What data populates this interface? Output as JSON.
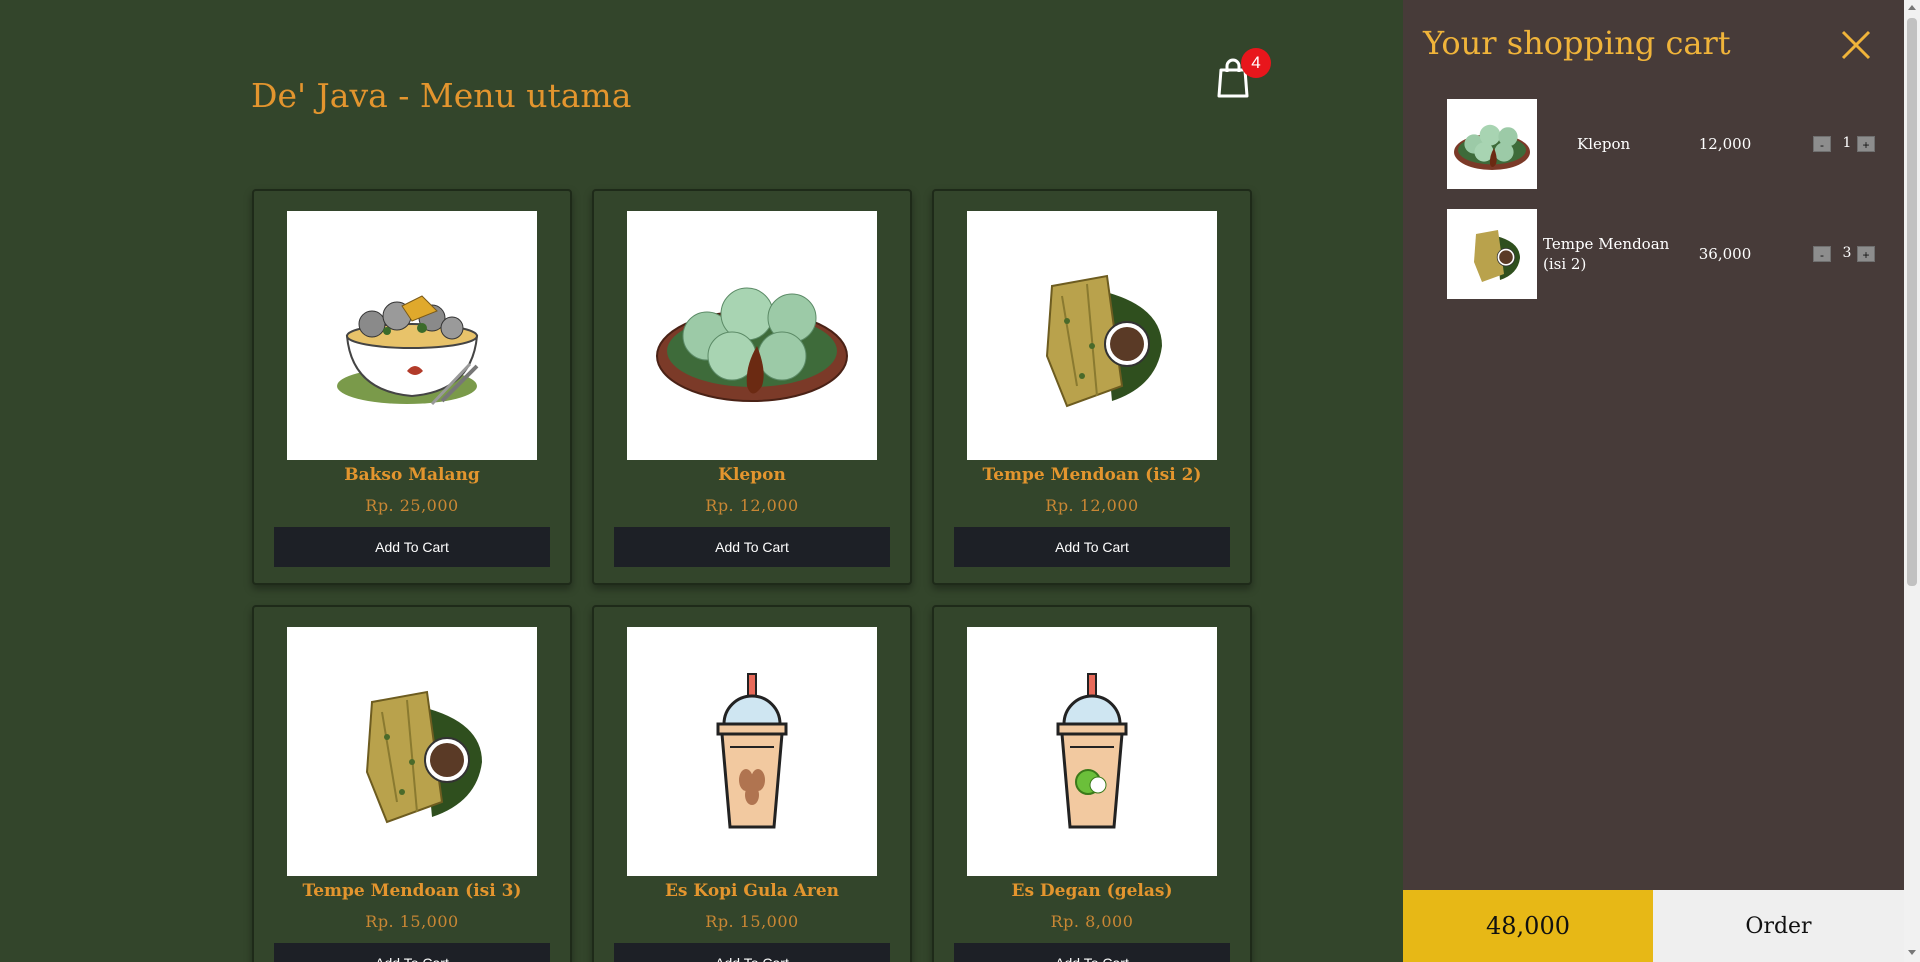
{
  "page": {
    "title": "De' Java - Menu utama",
    "cart_count": "4"
  },
  "menu": {
    "add_label": "Add To Cart",
    "items": [
      {
        "name": "Bakso Malang",
        "price": "Rp. 25,000",
        "icon": "bakso-bowl-icon"
      },
      {
        "name": "Klepon",
        "price": "Rp. 12,000",
        "icon": "klepon-plate-icon"
      },
      {
        "name": "Tempe Mendoan (isi 2)",
        "price": "Rp. 12,000",
        "icon": "tempe-mendoan-icon"
      },
      {
        "name": "Tempe Mendoan (isi 3)",
        "price": "Rp. 15,000",
        "icon": "tempe-mendoan-icon"
      },
      {
        "name": "Es Kopi Gula Aren",
        "price": "Rp. 15,000",
        "icon": "iced-coffee-cup-icon"
      },
      {
        "name": "Es Degan (gelas)",
        "price": "Rp. 8,000",
        "icon": "coconut-drink-cup-icon"
      }
    ]
  },
  "cart": {
    "title": "Your shopping cart",
    "items": [
      {
        "name": "Klepon",
        "price": "12,000",
        "qty": "1",
        "minus": "-",
        "plus": "+",
        "icon": "klepon-plate-icon"
      },
      {
        "name": "Tempe Mendoan (isi 2)",
        "price": "36,000",
        "qty": "3",
        "minus": "-",
        "plus": "+",
        "icon": "tempe-mendoan-icon"
      }
    ],
    "total": "48,000",
    "order_label": "Order"
  },
  "colors": {
    "background": "#33452b",
    "accent": "#e3952e",
    "cart_panel": "#473b39",
    "badge": "#e8161c",
    "total_bg": "#e7b816"
  }
}
